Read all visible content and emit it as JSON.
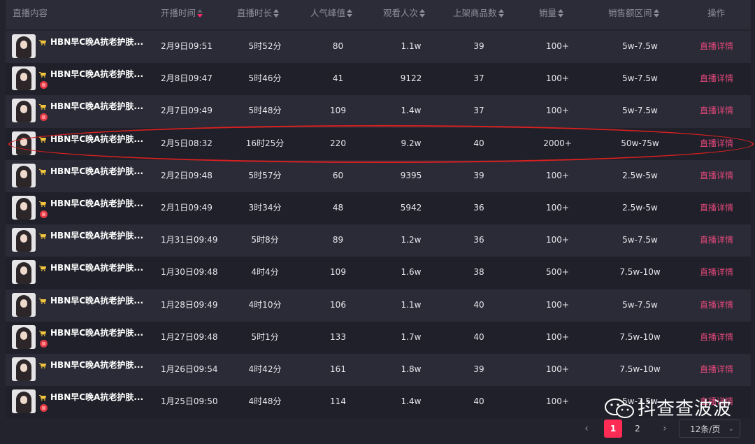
{
  "columns": {
    "content": "直播内容",
    "start_time": "开播时间",
    "duration": "直播时长",
    "peak": "人气峰值",
    "viewers": "观看人次",
    "products": "上架商品数",
    "sales": "销量",
    "revenue": "销售额区间",
    "action": "操作"
  },
  "rows": [
    {
      "title": "HBN早C晚A抗老护肤...",
      "gift": false,
      "start": "2月9日09:51",
      "duration": "5时52分",
      "peak": "80",
      "viewers": "1.1w",
      "products": "39",
      "sales": "100+",
      "revenue": "5w-7.5w",
      "action": "直播详情"
    },
    {
      "title": "HBN早C晚A抗老护肤...",
      "gift": true,
      "start": "2月8日09:47",
      "duration": "5时46分",
      "peak": "41",
      "viewers": "9122",
      "products": "37",
      "sales": "100+",
      "revenue": "5w-7.5w",
      "action": "直播详情"
    },
    {
      "title": "HBN早C晚A抗老护肤...",
      "gift": true,
      "start": "2月7日09:49",
      "duration": "5时48分",
      "peak": "109",
      "viewers": "1.4w",
      "products": "37",
      "sales": "100+",
      "revenue": "5w-7.5w",
      "action": "直播详情"
    },
    {
      "title": "HBN早C晚A抗老护肤...",
      "gift": false,
      "start": "2月5日08:32",
      "duration": "16时25分",
      "peak": "220",
      "viewers": "9.2w",
      "products": "40",
      "sales": "2000+",
      "revenue": "50w-75w",
      "action": "直播详情"
    },
    {
      "title": "HBN早C晚A抗老护肤...",
      "gift": false,
      "start": "2月2日09:48",
      "duration": "5时57分",
      "peak": "60",
      "viewers": "9395",
      "products": "39",
      "sales": "100+",
      "revenue": "2.5w-5w",
      "action": "直播详情"
    },
    {
      "title": "HBN早C晚A抗老护肤...",
      "gift": true,
      "start": "2月1日09:49",
      "duration": "3时34分",
      "peak": "48",
      "viewers": "5942",
      "products": "36",
      "sales": "100+",
      "revenue": "2.5w-5w",
      "action": "直播详情"
    },
    {
      "title": "HBN早C晚A抗老护肤...",
      "gift": false,
      "start": "1月31日09:49",
      "duration": "5时8分",
      "peak": "89",
      "viewers": "1.2w",
      "products": "36",
      "sales": "100+",
      "revenue": "5w-7.5w",
      "action": "直播详情"
    },
    {
      "title": "HBN早C晚A抗老护肤...",
      "gift": false,
      "start": "1月30日09:48",
      "duration": "4时4分",
      "peak": "109",
      "viewers": "1.6w",
      "products": "38",
      "sales": "500+",
      "revenue": "7.5w-10w",
      "action": "直播详情"
    },
    {
      "title": "HBN早C晚A抗老护肤...",
      "gift": false,
      "start": "1月28日09:49",
      "duration": "4时10分",
      "peak": "106",
      "viewers": "1.1w",
      "products": "40",
      "sales": "100+",
      "revenue": "5w-7.5w",
      "action": "直播详情"
    },
    {
      "title": "HBN早C晚A抗老护肤...",
      "gift": true,
      "start": "1月27日09:48",
      "duration": "5时1分",
      "peak": "133",
      "viewers": "1.7w",
      "products": "40",
      "sales": "100+",
      "revenue": "7.5w-10w",
      "action": "直播详情"
    },
    {
      "title": "HBN早C晚A抗老护肤...",
      "gift": false,
      "start": "1月26日09:54",
      "duration": "4时42分",
      "peak": "161",
      "viewers": "1.8w",
      "products": "39",
      "sales": "100+",
      "revenue": "7.5w-10w",
      "action": "直播详情"
    },
    {
      "title": "HBN早C晚A抗老护肤...",
      "gift": true,
      "start": "1月25日09:50",
      "duration": "4时48分",
      "peak": "114",
      "viewers": "1.4w",
      "products": "40",
      "sales": "100+",
      "revenue": "5w-7.5w",
      "action": "直播详情"
    }
  ],
  "pagination": {
    "prev": "‹",
    "pages": [
      "1",
      "2"
    ],
    "current": "1",
    "next": "›",
    "page_size": "12条/页",
    "dropdown": "⌄"
  },
  "watermark": "抖查查波波",
  "colors": {
    "accent": "#fe2c55",
    "link": "#e0487b",
    "highlight_ring": "#d92020"
  }
}
